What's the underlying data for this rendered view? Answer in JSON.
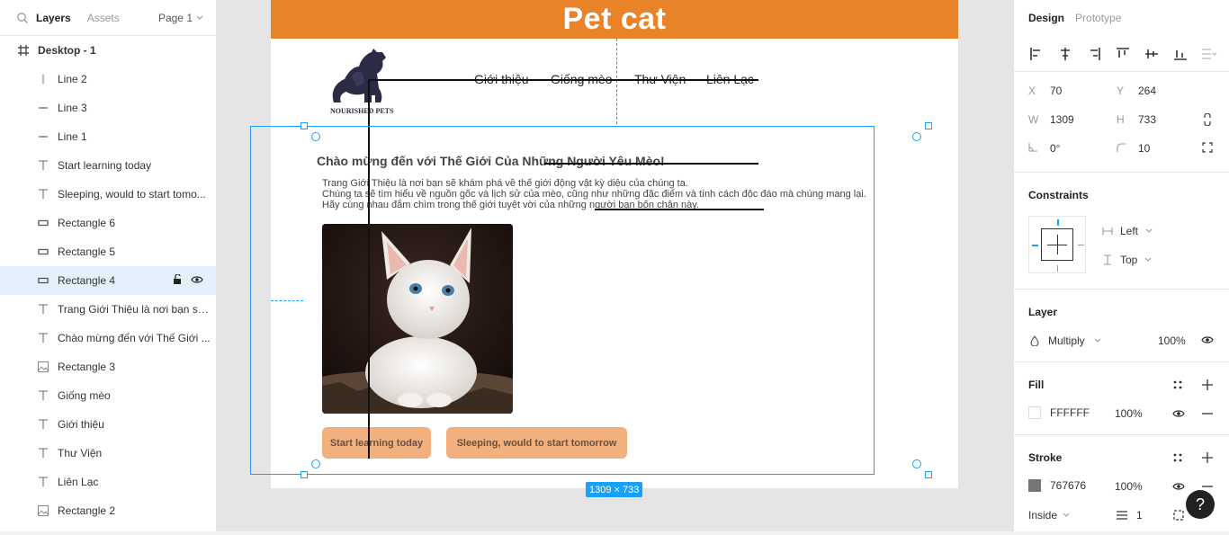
{
  "left_panel": {
    "tabs": [
      "Layers",
      "Assets"
    ],
    "page": "Page 1",
    "frame": "Desktop - 1",
    "layers": [
      {
        "label": "Line 2",
        "icon": "vertical-line-icon"
      },
      {
        "label": "Line 3",
        "icon": "horizontal-line-icon"
      },
      {
        "label": "Line 1",
        "icon": "horizontal-line-icon"
      },
      {
        "label": "Start learning today",
        "icon": "text-icon"
      },
      {
        "label": "Sleeping, would to start tomo...",
        "icon": "text-icon"
      },
      {
        "label": "Rectangle 6",
        "icon": "rectangle-icon"
      },
      {
        "label": "Rectangle 5",
        "icon": "rectangle-icon"
      },
      {
        "label": "Rectangle 4",
        "icon": "rectangle-icon",
        "selected": true
      },
      {
        "label": "Trang Giới Thiệu là nơi bạn sẽ ...",
        "icon": "text-icon"
      },
      {
        "label": "Chào mừng đến với Thế Giới ...",
        "icon": "text-icon"
      },
      {
        "label": "Rectangle 3",
        "icon": "image-icon"
      },
      {
        "label": "Giống mèo",
        "icon": "text-icon"
      },
      {
        "label": "Giới thiệu",
        "icon": "text-icon"
      },
      {
        "label": "Thư Viện",
        "icon": "text-icon"
      },
      {
        "label": "Liên Lạc",
        "icon": "text-icon"
      },
      {
        "label": "Rectangle 2",
        "icon": "image-icon"
      }
    ]
  },
  "canvas": {
    "header_title": "Pet cat",
    "logo_text": "NOURISHED PETS",
    "nav": [
      "Giới thiệu",
      "Giống mèo",
      "Thư Viện",
      "Liên Lạc"
    ],
    "welcome": "Chào mừng đến với Thế Giới Của Những Người Yêu Mèo!",
    "paragraph": [
      "Trang Giới Thiệu là nơi bạn sẽ khám phá về thế giới động vật kỳ diệu của chúng ta.",
      "Chúng ta sẽ tìm hiểu về nguồn gốc và lịch sử của mèo, cũng như những đặc điểm và tính cách độc đáo mà chúng mang lại.",
      "Hãy cùng nhau đắm chìm trong thế giới tuyệt vời của những người bạn bốn chân này."
    ],
    "button1": "Start learning today",
    "button2": "Sleeping, would to start tomorrow",
    "selection_size": "1309 × 733"
  },
  "right_panel": {
    "tabs": [
      "Design",
      "Prototype"
    ],
    "x_label": "X",
    "x": "70",
    "y_label": "Y",
    "y": "264",
    "w_label": "W",
    "w": "1309",
    "h_label": "H",
    "h": "733",
    "rotation": "0°",
    "radius": "10",
    "constraints_title": "Constraints",
    "constraint_h": "Left",
    "constraint_v": "Top",
    "layer_title": "Layer",
    "blend": "Multiply",
    "opacity": "100%",
    "fill_title": "Fill",
    "fill_hex": "FFFFFF",
    "fill_opacity": "100%",
    "fill_color": "#FFFFFF",
    "stroke_title": "Stroke",
    "stroke_hex": "767676",
    "stroke_opacity": "100%",
    "stroke_color": "#767676",
    "stroke_position": "Inside",
    "stroke_weight": "1"
  },
  "colors": {
    "accent": "#18a0fb",
    "header": "#e8832a",
    "button": "#f1b07e"
  }
}
